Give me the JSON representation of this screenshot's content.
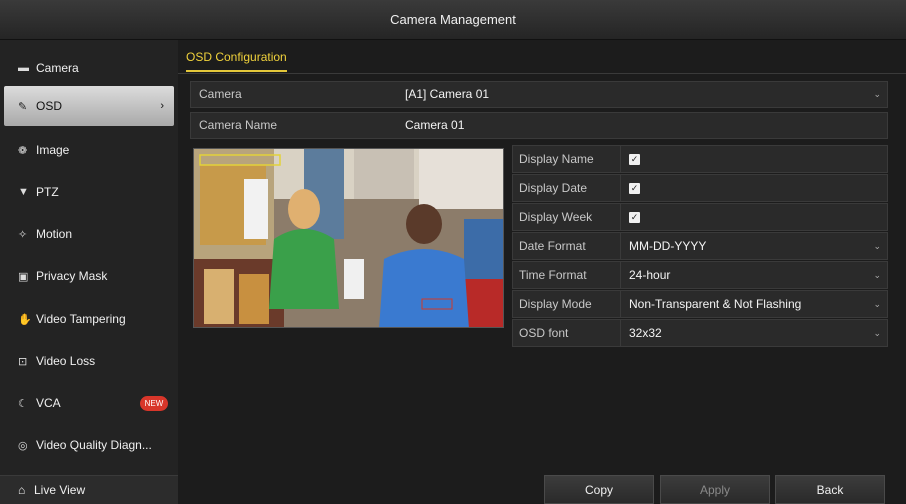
{
  "window": {
    "title": "Camera Management"
  },
  "sidebar": {
    "items": [
      {
        "label": "Camera",
        "icon": "camera-icon"
      },
      {
        "label": "OSD",
        "icon": "osd-icon",
        "active": true
      },
      {
        "label": "Image",
        "icon": "image-icon"
      },
      {
        "label": "PTZ",
        "icon": "ptz-icon"
      },
      {
        "label": "Motion",
        "icon": "motion-icon"
      },
      {
        "label": "Privacy Mask",
        "icon": "privacy-mask-icon"
      },
      {
        "label": "Video Tampering",
        "icon": "video-tampering-icon"
      },
      {
        "label": "Video Loss",
        "icon": "video-loss-icon"
      },
      {
        "label": "VCA",
        "icon": "vca-icon",
        "badge": "NEW"
      },
      {
        "label": "Video Quality Diagn...",
        "icon": "video-quality-icon"
      }
    ],
    "live_view": "Live View"
  },
  "main": {
    "tab": "OSD Configuration",
    "camera": {
      "label": "Camera",
      "value": "[A1] Camera 01"
    },
    "camera_name": {
      "label": "Camera Name",
      "value": "Camera 01"
    },
    "osd": [
      {
        "label": "Display Name",
        "checked": true
      },
      {
        "label": "Display Date",
        "checked": true
      },
      {
        "label": "Display Week",
        "checked": true
      },
      {
        "label": "Date Format",
        "value": "MM-DD-YYYY"
      },
      {
        "label": "Time Format",
        "value": "24-hour"
      },
      {
        "label": "Display Mode",
        "value": "Non-Transparent & Not Flashing"
      },
      {
        "label": "OSD font",
        "value": "32x32"
      }
    ]
  },
  "buttons": {
    "copy": "Copy",
    "apply": "Apply",
    "back": "Back"
  },
  "colors": {
    "accent": "#e3c73a",
    "badge": "#d8362a",
    "active_item": "#c8c8c8"
  }
}
